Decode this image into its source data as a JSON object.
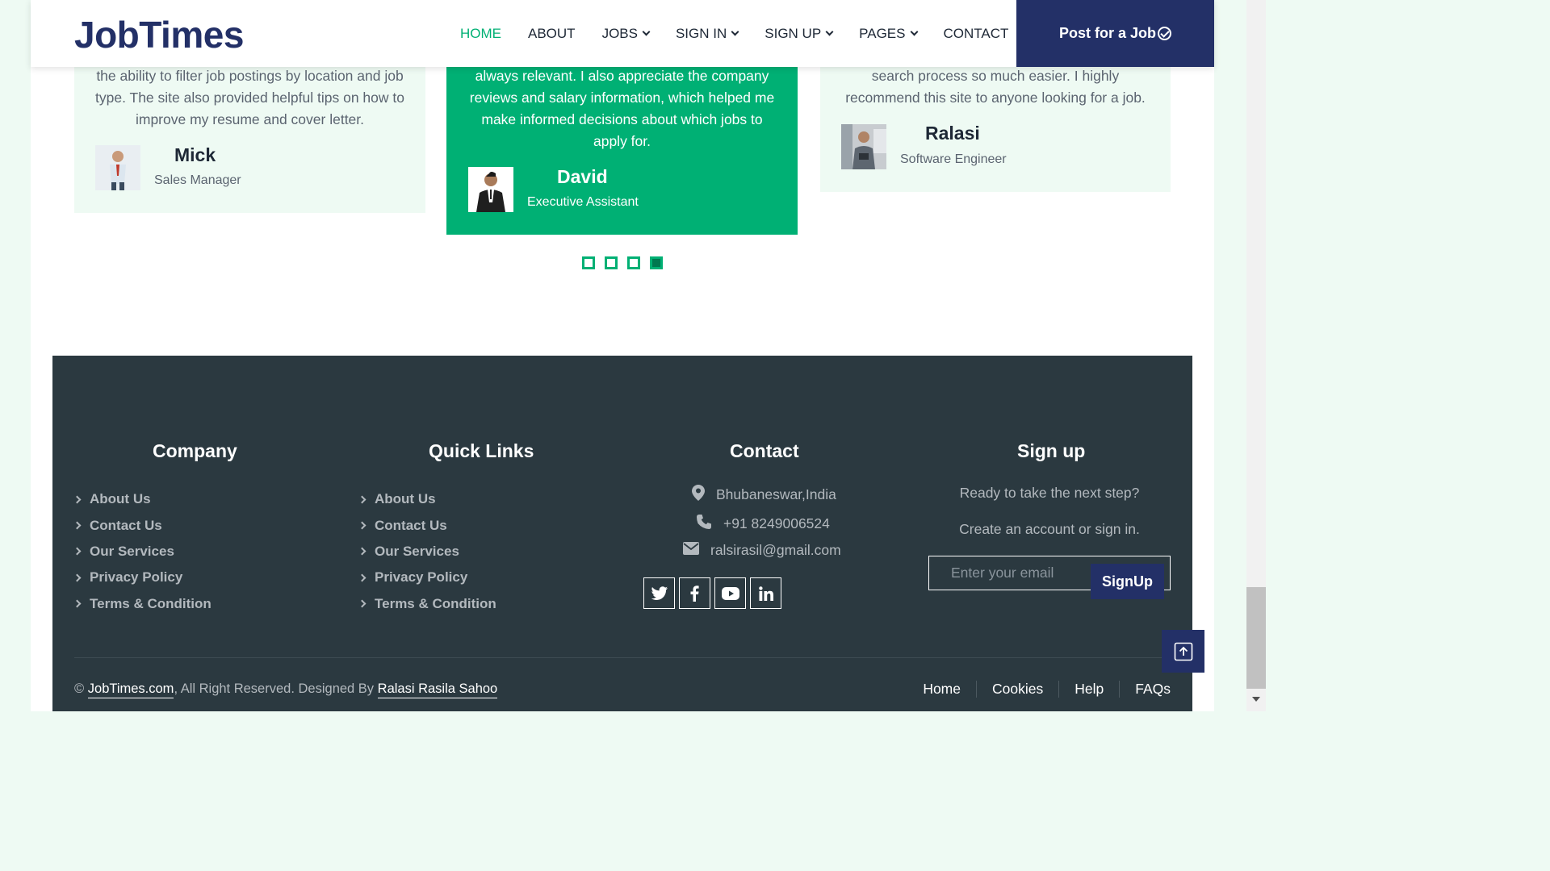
{
  "header": {
    "logo": "JobTimes",
    "nav": [
      {
        "label": "HOME",
        "active": true,
        "dropdown": false
      },
      {
        "label": "ABOUT",
        "active": false,
        "dropdown": false
      },
      {
        "label": "JOBS",
        "active": false,
        "dropdown": true
      },
      {
        "label": "SIGN IN",
        "active": false,
        "dropdown": true
      },
      {
        "label": "SIGN UP",
        "active": false,
        "dropdown": true
      },
      {
        "label": "PAGES",
        "active": false,
        "dropdown": true
      },
      {
        "label": "CONTACT",
        "active": false,
        "dropdown": false
      }
    ],
    "post_button": "Post for a Job"
  },
  "testimonials": [
    {
      "quote": "the ability to filter job postings by location and job type. The site also provided helpful tips on how to improve my resume and cover letter.",
      "name": "Mick",
      "role": "Sales Manager"
    },
    {
      "quote": "always relevant. I also appreciate the company reviews and salary information, which helped me make informed decisions about which jobs to apply for.",
      "name": "David",
      "role": "Executive Assistant"
    },
    {
      "quote": "search process so much easier. I highly recommend this site to anyone looking for a job.",
      "name": "Ralasi",
      "role": "Software Engineer"
    }
  ],
  "carousel": {
    "count": 4,
    "active_index": 3
  },
  "footer": {
    "company": {
      "title": "Company",
      "links": [
        "About Us",
        "Contact Us",
        "Our Services",
        "Privacy Policy",
        "Terms & Condition"
      ]
    },
    "quick_links": {
      "title": "Quick Links",
      "links": [
        "About Us",
        "Contact Us",
        "Our Services",
        "Privacy Policy",
        "Terms & Condition"
      ]
    },
    "contact": {
      "title": "Contact",
      "location": "Bhubaneswar,India",
      "phone": "+91 8249006524",
      "email": "ralsirasil@gmail.com",
      "socials": [
        "twitter-icon",
        "facebook-icon",
        "youtube-icon",
        "linkedin-icon"
      ]
    },
    "signup": {
      "title": "Sign up",
      "line1": "Ready to take the next step?",
      "line2": "Create an account or sign in.",
      "placeholder": "Enter your email",
      "button": "SignUp"
    },
    "copyright": {
      "prefix": "©",
      "site": "JobTimes.com",
      "middle": ", All Right Reserved. Designed By",
      "designer": "Ralasi Rasila Sahoo"
    },
    "bottom_links": [
      "Home",
      "Cookies",
      "Help",
      "FAQs"
    ]
  },
  "colors": {
    "accent": "#00b074",
    "brand": "#233067",
    "footer_bg": "#2b3940"
  }
}
